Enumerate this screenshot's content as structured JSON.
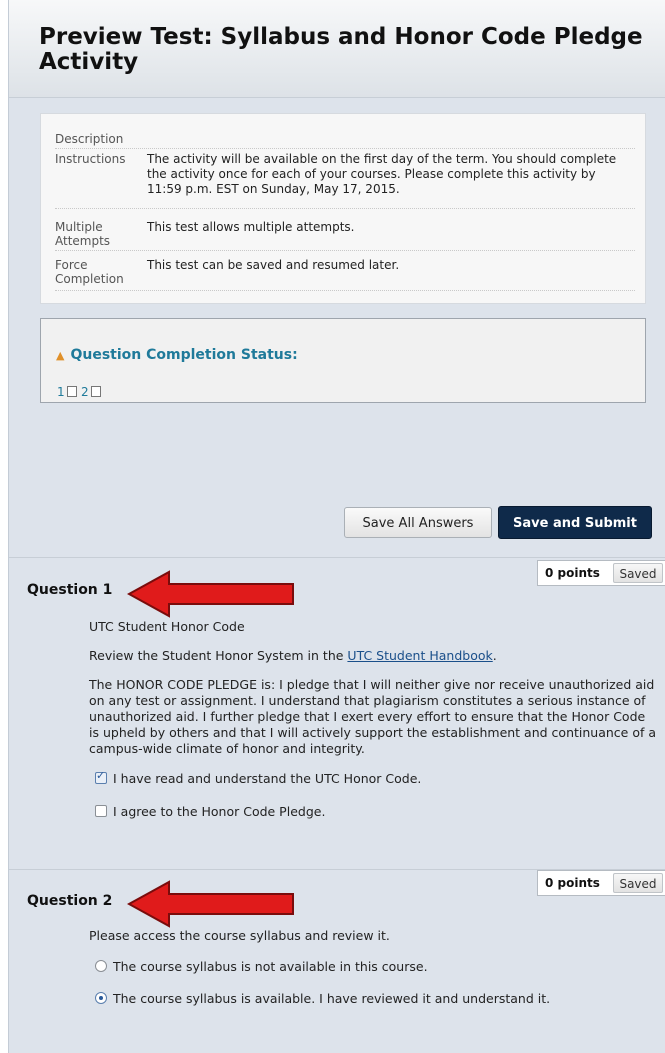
{
  "page": {
    "title": "Preview Test: Syllabus and Honor Code Pledge Activity"
  },
  "details": {
    "description_label": "Description",
    "description_value": "",
    "instructions_label": "Instructions",
    "instructions_value": "The activity will be available on the first day of the term. You should complete the activity once for each of your courses. Please complete this activity by 11:59 p.m. EST on Sunday, May 17, 2015.",
    "multiple_label": "Multiple Attempts",
    "multiple_value": "This test allows multiple attempts.",
    "force_label": "Force Completion",
    "force_value": "This test can be saved and resumed later."
  },
  "status": {
    "title": "Question Completion Status:",
    "questions": [
      "1",
      "2"
    ]
  },
  "actions": {
    "save_all": "Save All Answers",
    "save_submit": "Save and Submit"
  },
  "questions": [
    {
      "title": "Question 1",
      "points": "0 points",
      "saved": "Saved",
      "heading": "UTC Student Honor Code",
      "review_prefix": "Review the Student Honor System in the ",
      "review_link": "UTC Student Handbook",
      "review_suffix": ".",
      "pledge": "The HONOR CODE PLEDGE is:  I pledge that I will neither give nor receive unauthorized aid on any test or assignment.  I understand that plagiarism constitutes a serious instance of unauthorized aid.  I further pledge that I exert every effort to ensure that the Honor Code is upheld by others and that I will actively support the establishment and continuance of a campus-wide climate of honor and integrity.",
      "options": [
        {
          "label": "I have read and understand the UTC Honor Code.",
          "checked": true
        },
        {
          "label": "I agree to the Honor Code Pledge.",
          "checked": false
        }
      ]
    },
    {
      "title": "Question 2",
      "points": "0 points",
      "saved": "Saved",
      "prompt": "Please access the course syllabus and review it.",
      "options": [
        {
          "label": "The course syllabus is not available in this course.",
          "selected": false
        },
        {
          "label": "The course syllabus is available. I have reviewed it and understand it.",
          "selected": true
        }
      ]
    }
  ],
  "colors": {
    "page_bg": "#dde3eb",
    "link": "#1f7a9a",
    "submit_bg": "#0f2a4a",
    "arrow": "#e01b1b"
  }
}
